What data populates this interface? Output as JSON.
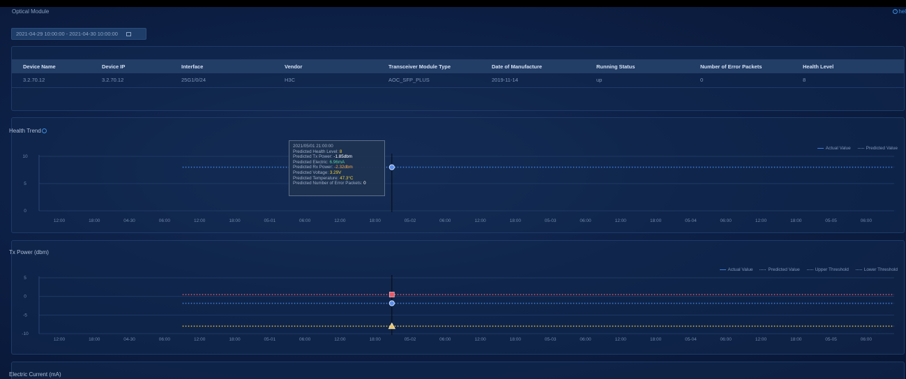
{
  "window": {
    "title": "Optical Module",
    "help_label": "hel"
  },
  "filter": {
    "date_range": "2021-04-29 10:00:00 - 2021-04-30 10:00:00"
  },
  "device_table": {
    "headers": [
      "Device Name",
      "Device IP",
      "Interface",
      "Vendor",
      "Transceiver Module Type",
      "Date of Manufacture",
      "Running Status",
      "Number of Error Packets",
      "Health Level"
    ],
    "rows": [
      [
        "3.2.70.12",
        "3.2.70.12",
        "25G1/0/24",
        "H3C",
        "AOC_SFP_PLUS",
        "2019-11-14",
        "up",
        "0",
        "8"
      ]
    ]
  },
  "x_ticks": [
    "12:00",
    "18:00",
    "04-30",
    "06:00",
    "12:00",
    "18:00",
    "05-01",
    "06:00",
    "12:00",
    "18:00",
    "05-02",
    "06:00",
    "12:00",
    "18:00",
    "05-03",
    "06:00",
    "12:00",
    "18:00",
    "05-04",
    "06:00",
    "12:00",
    "18:00",
    "05-05",
    "06:00"
  ],
  "charts": {
    "health_trend": {
      "title": "Health Trend",
      "legend": [
        "Actual Value",
        "Predicted Value"
      ],
      "y_ticks": [
        "10",
        "5",
        "0"
      ]
    },
    "tx_power": {
      "title": "Tx Power (dbm)",
      "legend": [
        "Actual Value",
        "Predicted Value",
        "Upper Threshold",
        "Lower Threshold"
      ],
      "y_ticks": [
        "5",
        "0",
        "-5",
        "-10"
      ]
    },
    "electric_current": {
      "title": "Electric Current (mA)"
    }
  },
  "tooltip": {
    "time": "2021/05/01 21:00:00",
    "rows": [
      {
        "label": "Predicted Health Level:",
        "value": "8"
      },
      {
        "label": "Predicted Tx Power:",
        "value": "-1.85dbm"
      },
      {
        "label": "Predicted Electric:",
        "value": "6.96mA"
      },
      {
        "label": "Predicted Rx Power:",
        "value": "-2.32dbm"
      },
      {
        "label": "Predicted Voltage:",
        "value": "3.29V"
      },
      {
        "label": "Predicted Temperature:",
        "value": "47.3°C"
      },
      {
        "label": "Predicted Number of Error Packets:",
        "value": "0"
      }
    ]
  },
  "chart_data": [
    {
      "type": "line",
      "title": "Health Trend",
      "xlabel": "",
      "ylabel": "",
      "ylim": [
        0,
        10
      ],
      "x_range": [
        "2021-04-29 10:00",
        "2021-05-05 09:00"
      ],
      "series": [
        {
          "name": "Predicted Value",
          "x": [
            "2021-04-30 10:00",
            "2021-05-05 09:00"
          ],
          "values": [
            8,
            8
          ]
        }
      ],
      "highlight": {
        "x": "2021-05-01 21:00",
        "value": 8
      },
      "grid": true,
      "legend_position": "top-right"
    },
    {
      "type": "line",
      "title": "Tx Power (dbm)",
      "xlabel": "",
      "ylabel": "",
      "ylim": [
        -10,
        5
      ],
      "x_range": [
        "2021-04-29 10:00",
        "2021-05-05 09:00"
      ],
      "series": [
        {
          "name": "Predicted Value",
          "x": [
            "2021-04-30 10:00",
            "2021-05-05 09:00"
          ],
          "values": [
            -1.85,
            -1.85
          ]
        },
        {
          "name": "Upper Threshold",
          "x": [
            "2021-04-30 10:00",
            "2021-05-05 09:00"
          ],
          "values": [
            0.5,
            0.5
          ]
        },
        {
          "name": "Lower Threshold",
          "x": [
            "2021-04-30 10:00",
            "2021-05-05 09:00"
          ],
          "values": [
            -8,
            -8
          ]
        }
      ],
      "highlight": {
        "x": "2021-05-01 21:00",
        "values": [
          -1.85,
          0.5,
          -8
        ]
      },
      "grid": true,
      "legend_position": "top-right"
    }
  ],
  "colors": {
    "actual": "#3e7ed8",
    "predicted": "#3e7ed8",
    "upper": "#e05a68",
    "lower": "#e0b840",
    "cursor": "#0a0a0a"
  }
}
